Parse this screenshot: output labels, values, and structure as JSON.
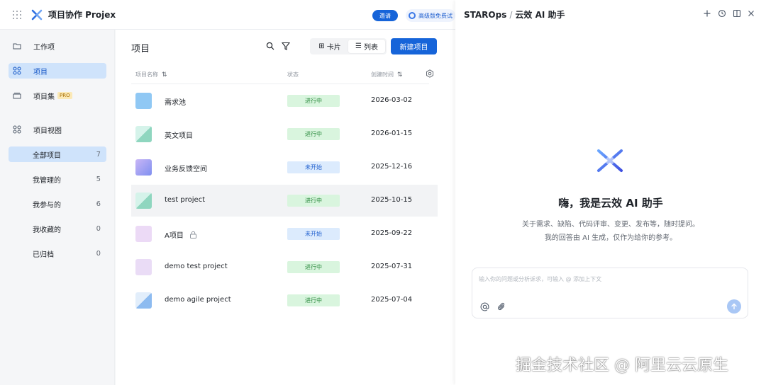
{
  "header": {
    "app_title": "项目协作 Projex",
    "invite_label": "邀请",
    "upgrade_label": "高级版免费试"
  },
  "sidebar": {
    "items": [
      {
        "label": "工作项"
      },
      {
        "label": "项目"
      },
      {
        "label": "项目集",
        "badge": "PRO"
      },
      {
        "label": "项目视图"
      }
    ],
    "views": [
      {
        "label": "全部项目",
        "count": "7"
      },
      {
        "label": "我管理的",
        "count": "5"
      },
      {
        "label": "我参与的",
        "count": "6"
      },
      {
        "label": "我收藏的",
        "count": "0"
      },
      {
        "label": "已归档",
        "count": "0"
      }
    ]
  },
  "main": {
    "title": "项目",
    "view_toggle": {
      "card": "卡片",
      "list": "列表"
    },
    "new_button": "新建项目",
    "columns": {
      "name": "项目名称",
      "status": "状态",
      "created": "创建时间"
    },
    "rows": [
      {
        "name": "需求池",
        "status": "进行中",
        "date": "2026-03-02",
        "thumb": "#90c8f4"
      },
      {
        "name": "英文项目",
        "status": "进行中",
        "date": "2026-01-15",
        "thumb": "#9bdcc7"
      },
      {
        "name": "业务反馈空间",
        "status": "未开始",
        "date": "2025-12-16",
        "thumb": "#a99ef0"
      },
      {
        "name": "test project",
        "status": "进行中",
        "date": "2025-10-15",
        "thumb": "#8fd6bf"
      },
      {
        "name": "A项目",
        "status": "未开始",
        "date": "2025-09-22",
        "thumb": "#ecdaf6"
      },
      {
        "name": "demo test project",
        "status": "进行中",
        "date": "2025-07-31",
        "thumb": "#eadcf6"
      },
      {
        "name": "demo agile project",
        "status": "进行中",
        "date": "2025-07-04",
        "thumb": "#b5d3f4"
      }
    ]
  },
  "ai_panel": {
    "brand": "STAROps",
    "separator": "/",
    "title": "云效 AI 助手",
    "greeting": "嗨，我是云效 AI 助手",
    "desc_line1": "关于需求、缺陷、代码评审、变更、发布等，随时提问。",
    "desc_line2": "我的回答由 AI 生成，仅作为给你的参考。",
    "input_placeholder": "输入你的问题或分析诉求，可输入 @ 添加上下文"
  },
  "watermark": "掘金技术社区 @ 阿里云云原生",
  "colors": {
    "primary": "#1664d9",
    "active_bg": "#cfe3fb",
    "in_progress_bg": "#d9f5de",
    "not_started_bg": "#dcebfd"
  }
}
